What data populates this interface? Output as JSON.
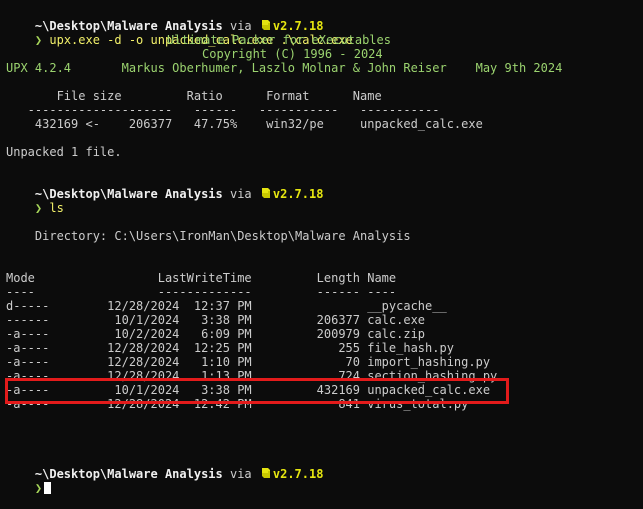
{
  "prompt": {
    "path": "~\\Desktop\\Malware Analysis",
    "via": " via ",
    "python_version": "v2.7.18",
    "arrow": "❯"
  },
  "commands": {
    "upx": " upx.exe -d -o unpacked_calc.exe .\\calc.exe",
    "ls": " ls"
  },
  "upx_banner": {
    "title": "Ultimate Packer for eXecutables",
    "copyright": "Copyright (C) 1996 - 2024",
    "version_line": "UPX 4.2.4       Markus Oberhumer, Laszlo Molnar & John Reiser    May 9th 2024"
  },
  "upx_table": {
    "header": "       File size         Ratio      Format      Name",
    "separator": "   --------------------   ------   -----------   -----------",
    "row": "    432169 <-    206377   47.75%    win32/pe     unpacked_calc.exe",
    "summary": "Unpacked 1 file."
  },
  "directory_line": "    Directory: C:\\Users\\IronMan\\Desktop\\Malware Analysis",
  "listing": {
    "header": "Mode                 LastWriteTime         Length Name",
    "separator": "----                 -------------         ------ ----",
    "rows": [
      "d-----        12/28/2024  12:37 PM                __pycache__",
      "------         10/1/2024   3:38 PM         206377 calc.exe",
      "-a----         10/2/2024   6:09 PM         200979 calc.zip",
      "-a----        12/28/2024  12:25 PM            255 file_hash.py",
      "-a----        12/28/2024   1:10 PM             70 import_hashing.py",
      "-a----        12/28/2024   1:13 PM            724 section_hashing.py",
      "-a----         10/1/2024   3:38 PM         432169 unpacked_calc.exe",
      "-a----        12/28/2024  12:42 PM            841 virus_total.py"
    ]
  },
  "colors": {
    "background": "#0c0c0c",
    "text": "#cccccc",
    "prompt_path": "#f0f0f0",
    "python_version": "#e5e510",
    "highlight_box": "#e31b1b"
  }
}
